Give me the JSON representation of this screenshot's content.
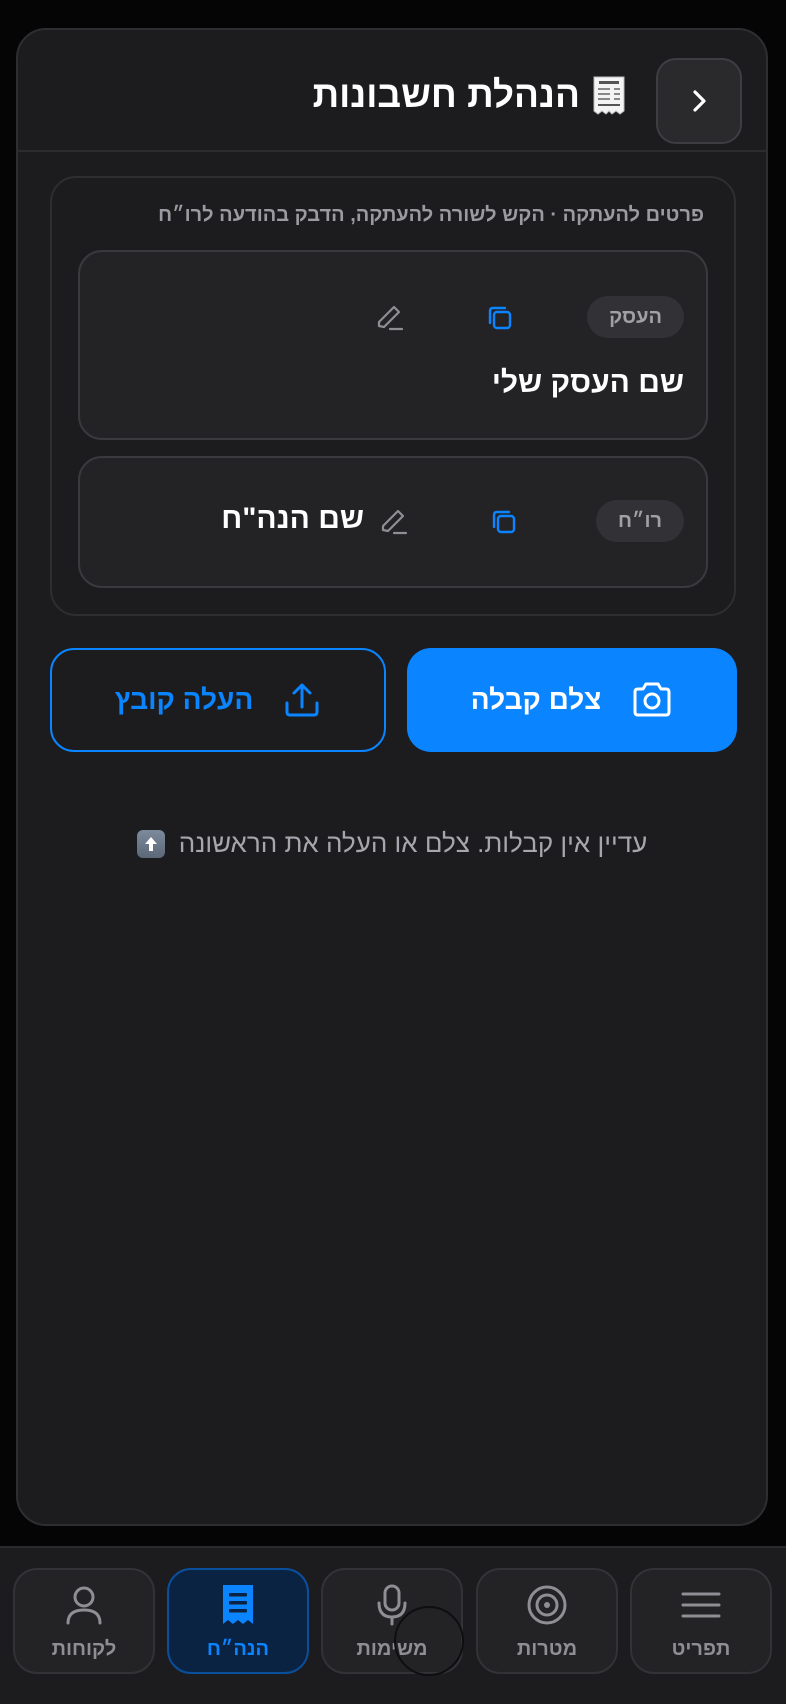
{
  "header": {
    "title": "הנהלת חשבונות",
    "title_icon": "receipt-emoji",
    "back_icon": "chevron-right-icon"
  },
  "details": {
    "hint": "פרטים להעתקה · הקש לשורה להעתקה, הדבק בהודעה לרו״ח",
    "rows": [
      {
        "chip": "העסק",
        "value": "שם העסק שלי",
        "copy_icon": "copy-icon",
        "edit_icon": "pencil-icon"
      },
      {
        "chip": "רו״ח",
        "value": "שם הנה\"ח",
        "copy_icon": "copy-icon",
        "edit_icon": "pencil-icon"
      }
    ]
  },
  "actions": {
    "camera_label": "צלם קבלה",
    "upload_label": "העלה קובץ"
  },
  "empty_state": {
    "text": "עדיין אין קבלות. צלם או העלה את הראשונה",
    "emoji": "up-arrow-emoji"
  },
  "tabs": [
    {
      "label": "תפריט",
      "icon": "menu-icon",
      "active": false
    },
    {
      "label": "מטרות",
      "icon": "target-icon",
      "active": false
    },
    {
      "label": "משימות",
      "icon": "microphone-icon",
      "active": false
    },
    {
      "label": "הנה״ח",
      "icon": "receipt-icon",
      "active": true
    },
    {
      "label": "לקוחות",
      "icon": "person-icon",
      "active": false
    }
  ],
  "colors": {
    "accent": "#0a84ff",
    "background": "#1c1c1e",
    "card_border": "#3a3a3e"
  }
}
